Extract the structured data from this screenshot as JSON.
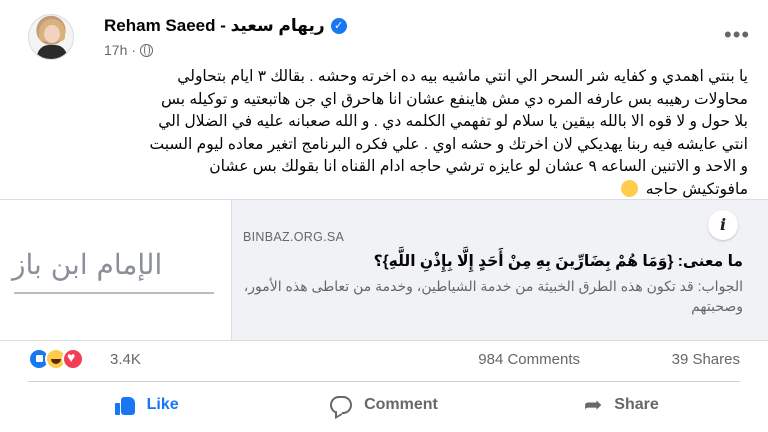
{
  "post": {
    "author_name": "Reham Saeed - ريهام سعيد",
    "verified_icon": "verified-badge-icon",
    "timestamp": "17h",
    "separator": "·",
    "audience_icon": "globe-icon",
    "more_icon": "more-options-icon",
    "text_lines": [
      "يا بنتي اهمدي و كفايه شر السحر الي انتي ماشيه بيه ده اخرته وحشه . بقالك ٣ ايام بتحاولي",
      "محاولات رهيبه بس عارفه المره دي مش هاينفع عشان  انا هاحرق اي جن هاتبعتيه و توكيله بس",
      "بلا حول و لا قوه الا بالله بيقين يا سلام لو تفهمي الكلمه دي . و الله صعبانه عليه في الضلال الي",
      "انتي عايشه فيه ربنا يهديكي لان اخرتك و حشه اوي . علي فكره البرنامج اتغير معاده ليوم السبت",
      "و الاحد و الاتنين الساعه ٩ عشان لو عايزه ترشي حاجه ادام القناه انا بقولك بس عشان",
      "مافوتكيش حاجه"
    ],
    "emoji_icon": "laughing-tears-emoji-icon"
  },
  "link_card": {
    "image_logo_text": "الإمام ابن باز",
    "domain": "BINBAZ.ORG.SA",
    "title": "ما معنى: {وَمَا هُمْ بِضَارِّينَ بِهِ مِنْ أَحَدٍ إِلَّا بِإِذْنِ اللَّهِ}؟",
    "description": "الجواب: قد تكون هذه الطرق الخبيثة من خدمة الشياطين، وخدمة من تعاطى هذه الأمور، وصحبتهم",
    "info_icon": "info-icon",
    "info_label": "i"
  },
  "stats": {
    "reaction_icons": [
      "like-reaction-icon",
      "haha-reaction-icon",
      "love-reaction-icon"
    ],
    "reaction_count": "3.4K",
    "comments": "984 Comments",
    "shares": "39 Shares"
  },
  "actions": {
    "like_label": "Like",
    "comment_label": "Comment",
    "share_label": "Share"
  },
  "colors": {
    "accent": "#1877f2",
    "secondary_text": "#65676b",
    "card_background": "#f0f2f5"
  }
}
